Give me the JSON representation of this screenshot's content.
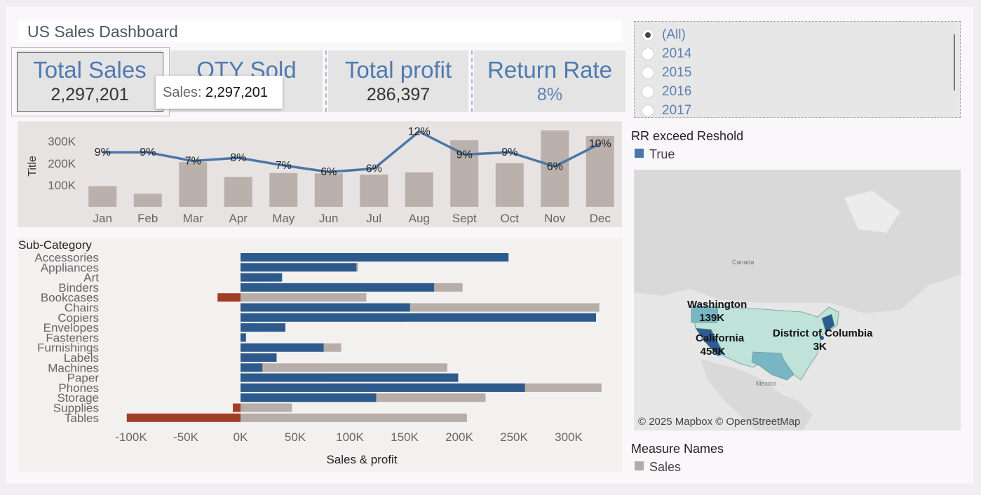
{
  "dashboard": {
    "title": "US Sales Dashboard"
  },
  "kpis": [
    {
      "label": "Total Sales",
      "value": "2,297,201"
    },
    {
      "label": "QTY Sold",
      "value": ""
    },
    {
      "label": "Total profit",
      "value": "286,397"
    },
    {
      "label": "Return Rate",
      "value": "8%"
    }
  ],
  "tooltip": {
    "label": "Sales:",
    "value": "2,297,201"
  },
  "year_filter": {
    "options": [
      "(All)",
      "2014",
      "2015",
      "2016",
      "2017"
    ],
    "selected": "(All)"
  },
  "rr_legend": {
    "title": "RR exceed Reshold",
    "item": "True",
    "color": "#4a76a8"
  },
  "measure_legend": {
    "title": "Measure Names",
    "item": "Sales",
    "color": "#b3aba7"
  },
  "map": {
    "credit": "© 2025 Mapbox © OpenStreetMap",
    "places": {
      "canada": "Canada",
      "mexico": "Mexico"
    },
    "labels": [
      {
        "state": "Washington",
        "value": "139K"
      },
      {
        "state": "California",
        "value": "458K"
      },
      {
        "state": "District of Columbia",
        "value": "3K"
      }
    ]
  },
  "colors": {
    "sales_bar": "#b7ada9",
    "profit_pos": "#2c5a8c",
    "profit_neg": "#a13e25",
    "line": "#4b77a8",
    "month_bar": "#bab0ac"
  },
  "chart_data": [
    {
      "type": "bar",
      "ylabel": "Title",
      "categories": [
        "Jan",
        "Feb",
        "Mar",
        "Apr",
        "May",
        "Jun",
        "Jul",
        "Aug",
        "Sept",
        "Oct",
        "Nov",
        "Dec"
      ],
      "yticks": [
        "100K",
        "200K",
        "300K"
      ],
      "ylim": [
        0,
        360000
      ],
      "series": [
        {
          "values": [
            95000,
            60000,
            205000,
            137000,
            155000,
            153000,
            148000,
            158000,
            305000,
            200000,
            350000,
            325000
          ]
        }
      ],
      "return_rate_line": {
        "labels": [
          "9%",
          "9%",
          "7%",
          "8%",
          "7%",
          "6%",
          "6%",
          "12%",
          "9%",
          "9%",
          "6%",
          "10%"
        ],
        "values": [
          250000,
          250000,
          210000,
          225000,
          190000,
          160000,
          175000,
          345000,
          240000,
          250000,
          185000,
          290000
        ]
      }
    },
    {
      "type": "bar",
      "orientation": "horizontal",
      "title": "Sub-Category",
      "xlabel": "Sales & profit",
      "xticks": [
        "-100K",
        "-50K",
        "0K",
        "50K",
        "100K",
        "150K",
        "200K",
        "250K",
        "300K"
      ],
      "xlim": [
        -110000,
        335000
      ],
      "categories": [
        "Accessories",
        "Appliances",
        "Art",
        "Binders",
        "Bookcases",
        "Chairs",
        "Copiers",
        "Envelopes",
        "Fasteners",
        "Furnishings",
        "Labels",
        "Machines",
        "Paper",
        "Phones",
        "Storage",
        "Supplies",
        "Tables"
      ],
      "series": [
        {
          "name": "Sales",
          "values": [
            167000,
            107500,
            27000,
            203000,
            115000,
            328000,
            150000,
            16500,
            3000,
            92000,
            12500,
            189000,
            78500,
            330000,
            224000,
            47000,
            207000
          ]
        },
        {
          "name": "Profit",
          "values": [
            245000,
            106000,
            38000,
            177000,
            -21000,
            155000,
            325000,
            41000,
            5000,
            76000,
            33000,
            20000,
            199000,
            260000,
            124000,
            -7000,
            -104000
          ]
        }
      ]
    }
  ]
}
